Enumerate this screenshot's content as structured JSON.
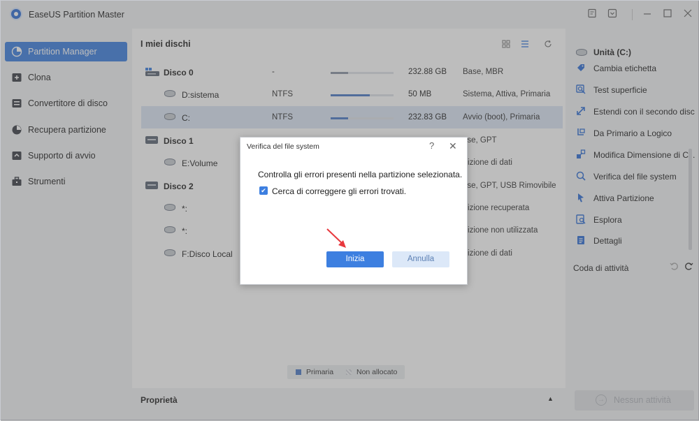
{
  "app": {
    "title": "EaseUS Partition Master"
  },
  "sidebar": {
    "items": [
      {
        "label": "Partition Manager",
        "icon": "partition-manager-icon",
        "active": true
      },
      {
        "label": "Clona",
        "icon": "clone-icon"
      },
      {
        "label": "Convertitore di disco",
        "icon": "disk-converter-icon"
      },
      {
        "label": "Recupera partizione",
        "icon": "recover-partition-icon"
      },
      {
        "label": "Supporto di avvio",
        "icon": "boot-media-icon"
      },
      {
        "label": "Strumenti",
        "icon": "toolbox-icon"
      }
    ]
  },
  "main": {
    "title": "I miei dischi",
    "rows": [
      {
        "kind": "disk",
        "name": "Disco 0",
        "fs": "-",
        "usage": 0.28,
        "size": "232.88 GB",
        "type": "Base, MBR"
      },
      {
        "kind": "partition",
        "name": "D:sistema",
        "fs": "NTFS",
        "usage": 0.62,
        "size": "50 MB",
        "type": "Sistema, Attiva, Primaria"
      },
      {
        "kind": "partition",
        "name": "C:",
        "fs": "NTFS",
        "usage": 0.28,
        "size": "232.83 GB",
        "type": "Avvio (boot), Primaria",
        "selected": true
      },
      {
        "kind": "disk",
        "name": "Disco 1",
        "type": "ase, GPT"
      },
      {
        "kind": "partition",
        "name": "E:Volume",
        "type": "rtizione di dati"
      },
      {
        "kind": "disk",
        "name": "Disco 2",
        "type": "ase, GPT, USB Rimovibile"
      },
      {
        "kind": "partition",
        "name": "*:",
        "type": "rtizione recuperata"
      },
      {
        "kind": "partition",
        "name": "*:",
        "type": "rtizione non utilizzata"
      },
      {
        "kind": "partition",
        "name": "F:Disco Local",
        "type": "rtizione di dati"
      }
    ],
    "legend": {
      "primary": "Primaria",
      "unallocated": "Non allocato"
    }
  },
  "properties": {
    "label": "Proprietà"
  },
  "right_panel": {
    "drive": "Unità (C:)",
    "actions": [
      {
        "label": "Cambia etichetta",
        "icon": "label-icon"
      },
      {
        "label": "Test superficie",
        "icon": "surface-test-icon"
      },
      {
        "label": "Estendi con il secondo disco",
        "icon": "extend-icon"
      },
      {
        "label": "Da Primario a Logico",
        "icon": "convert-logical-icon"
      },
      {
        "label": "Modifica Dimensione di Cl...",
        "icon": "cluster-size-icon"
      },
      {
        "label": "Verifica del file system",
        "icon": "check-filesystem-icon"
      },
      {
        "label": "Attiva Partizione",
        "icon": "activate-partition-icon"
      },
      {
        "label": "Esplora",
        "icon": "explore-icon"
      },
      {
        "label": "Dettagli",
        "icon": "details-icon"
      }
    ],
    "queue_label": "Coda di attività",
    "execute_button": "Nessun attività"
  },
  "dialog": {
    "title": "Verifica del file system",
    "message": "Controlla gli errori presenti nella partizione selezionata.",
    "checkbox_label": "Cerca di correggere gli errori trovati.",
    "checkbox_checked": true,
    "start_button": "Inizia",
    "cancel_button": "Annulla"
  },
  "colors": {
    "accent": "#3d7fe0",
    "pointer": "#e8383d"
  }
}
